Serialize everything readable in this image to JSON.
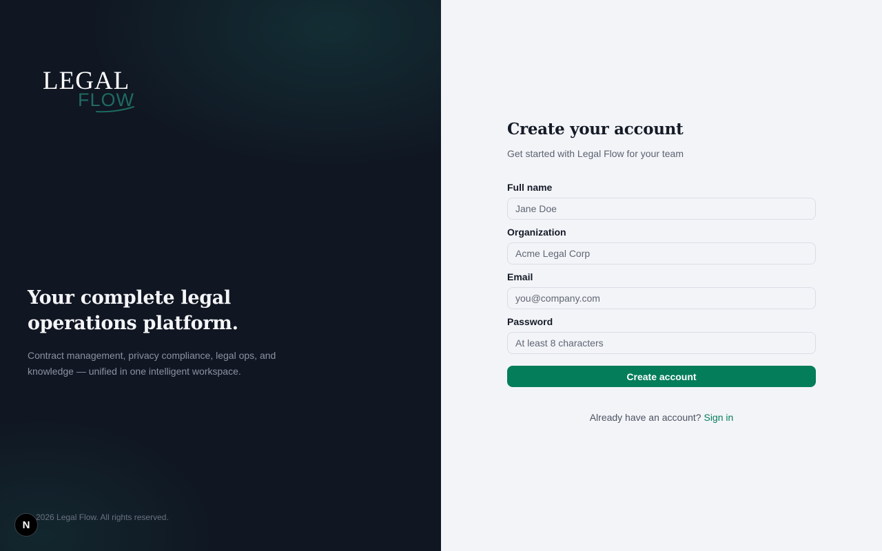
{
  "brand": {
    "logo_word_1": "LEGAL",
    "logo_word_2": "FLOW",
    "accent_color": "#037d5a",
    "logo_flow_color": "#1f6b61"
  },
  "hero": {
    "headline": "Your complete legal operations platform.",
    "description": "Contract management, privacy compliance, legal ops, and knowledge — unified in one intelligent workspace.",
    "copyright": "2026 Legal Flow. All rights reserved."
  },
  "form": {
    "title": "Create your account",
    "subtitle": "Get started with Legal Flow for your team",
    "fields": [
      {
        "label": "Full name",
        "placeholder": "Jane Doe",
        "value": ""
      },
      {
        "label": "Organization",
        "placeholder": "Acme Legal Corp",
        "value": ""
      },
      {
        "label": "Email",
        "placeholder": "you@company.com",
        "value": ""
      },
      {
        "label": "Password",
        "placeholder": "At least 8 characters",
        "value": ""
      }
    ],
    "submit_label": "Create account",
    "signin_prompt": "Already have an account?",
    "signin_link": "Sign in"
  },
  "dev_badge": {
    "letter": "N",
    "icon": "nextjs-icon"
  }
}
